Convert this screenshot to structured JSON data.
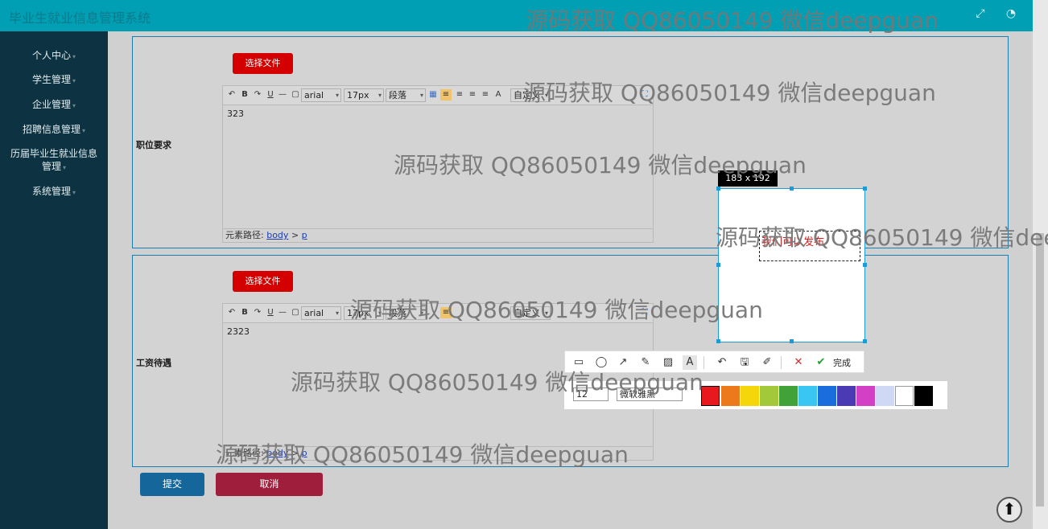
{
  "header": {
    "app_title": "毕业生就业信息管理系统"
  },
  "sidebar": {
    "items": [
      {
        "label": "个人中心"
      },
      {
        "label": "学生管理"
      },
      {
        "label": "企业管理"
      },
      {
        "label": "招聘信息管理"
      },
      {
        "label": "历届毕业生就业信息管理"
      },
      {
        "label": "系统管理"
      }
    ]
  },
  "form": {
    "sections": [
      {
        "label": "职位要求",
        "file_button": "选择文件",
        "editor": {
          "content": "323",
          "path_prefix": "元素路径:",
          "path_body": "body",
          "path_sep": ">",
          "path_p": "p"
        }
      },
      {
        "label": "工资待遇",
        "file_button": "选择文件",
        "editor": {
          "content": "2323",
          "path_prefix": "元素路径:",
          "path_body": "body",
          "path_sep": ">",
          "path_p": "p"
        }
      }
    ],
    "toolbar": {
      "font": "arial",
      "size": "17px",
      "paragraph": "段落",
      "custom": "自定义"
    },
    "submit_label": "提交",
    "cancel_label": "取消"
  },
  "screenshot_tool": {
    "size_tag": "183 x 192",
    "text_box": "我们可以发布",
    "done_label": "完成",
    "font_size": "12",
    "font_name": "微软雅黑",
    "palette": [
      "#e8181f",
      "#ec7a1a",
      "#f4d60a",
      "#a2c93a",
      "#42a23a",
      "#3ac6f2",
      "#1a6ddc",
      "#4a3bb5",
      "#d340c6",
      "#cfd8f5",
      "#ffffff",
      "#000000"
    ]
  },
  "watermark": "源码获取 QQ86050149 微信deepguan"
}
